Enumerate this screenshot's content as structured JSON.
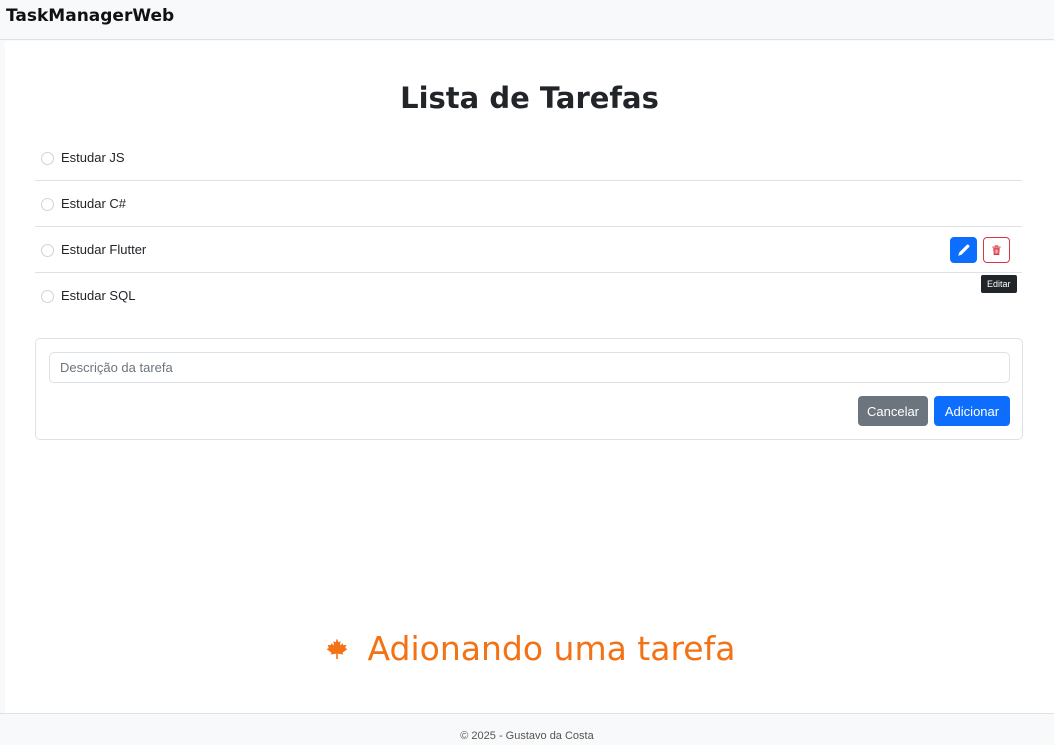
{
  "navbar": {
    "brand": "TaskManagerWeb"
  },
  "main": {
    "title": "Lista de Tarefas",
    "tasks": [
      {
        "label": "Estudar JS"
      },
      {
        "label": "Estudar C#"
      },
      {
        "label": "Estudar Flutter",
        "hovered": true
      },
      {
        "label": "Estudar SQL"
      }
    ],
    "actions": {
      "edit_icon": "pencil-icon",
      "delete_icon": "trash-icon",
      "tooltip": "Editar"
    },
    "form": {
      "input_placeholder": "Descrição da tarefa",
      "input_value": "",
      "cancel_label": "Cancelar",
      "add_label": "Adicionar"
    }
  },
  "caption": {
    "icon": "maple-leaf-icon",
    "text": "Adionando uma tarefa"
  },
  "footer": {
    "text": "© 2025 - Gustavo da Costa"
  },
  "colors": {
    "primary": "#0d6efd",
    "danger": "#dc3545",
    "secondary": "#6c757d",
    "caption": "#f47216"
  }
}
